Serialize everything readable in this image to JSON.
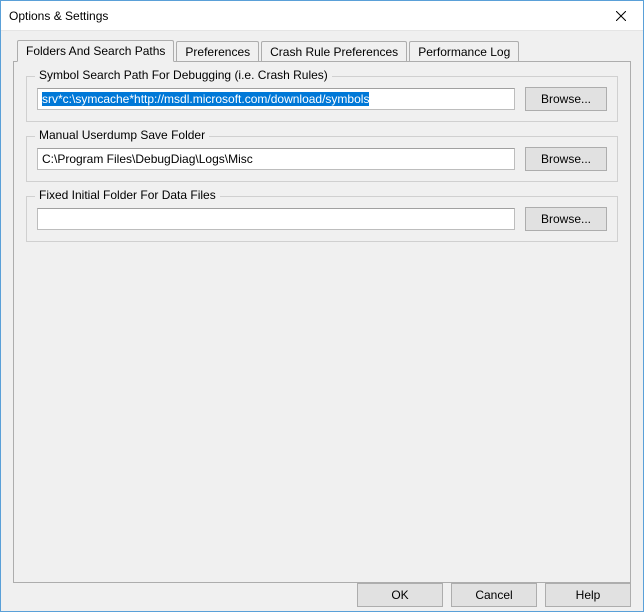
{
  "window": {
    "title": "Options & Settings"
  },
  "tabs": {
    "folders": "Folders And Search Paths",
    "preferences": "Preferences",
    "crash": "Crash Rule Preferences",
    "perf": "Performance Log"
  },
  "groups": {
    "symbol": {
      "legend": "Symbol Search Path For Debugging   (i.e. Crash Rules)",
      "value": "srv*c:\\symcache*http://msdl.microsoft.com/download/symbols",
      "browse": "Browse..."
    },
    "userdump": {
      "legend": "Manual Userdump Save Folder",
      "value": "C:\\Program Files\\DebugDiag\\Logs\\Misc",
      "browse": "Browse..."
    },
    "fixed": {
      "legend": "Fixed Initial Folder For Data Files",
      "value": "",
      "browse": "Browse..."
    }
  },
  "footer": {
    "ok": "OK",
    "cancel": "Cancel",
    "help": "Help"
  }
}
